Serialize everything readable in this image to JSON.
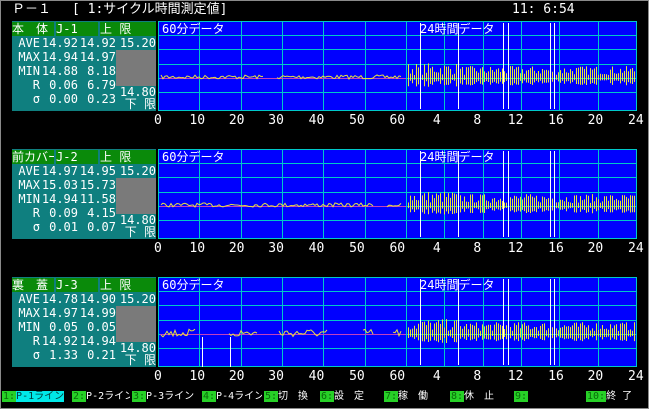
{
  "header": {
    "screen_id": "Ｐ－１",
    "title": "[ 1:サイクル時間測定値]",
    "clock": "11: 6:54"
  },
  "stat_labels": [
    "AVE",
    "MAX",
    "MIN",
    "R",
    "σ"
  ],
  "x_ticks": [
    "0",
    "10",
    "20",
    "30",
    "40",
    "50",
    "60",
    "4",
    "8",
    "12",
    "16",
    "20",
    "24"
  ],
  "panels": [
    {
      "name": "本　体",
      "code": "J-1",
      "upper_label": "上 限",
      "lower_label": "下 限",
      "upper_limit": "15.20",
      "lower_limit": "14.80",
      "stats": [
        [
          "14.92",
          "14.92"
        ],
        [
          "14.94",
          "14.97"
        ],
        [
          "14.88",
          "8.18"
        ],
        [
          "0.06",
          "6.79"
        ],
        [
          "0.00",
          "0.23"
        ]
      ],
      "chart_60min_title": "60分データ",
      "chart_24h_title": "24時間データ"
    },
    {
      "name": "前カバー",
      "code": "J-2",
      "upper_label": "上 限",
      "lower_label": "下 限",
      "upper_limit": "15.20",
      "lower_limit": "14.80",
      "stats": [
        [
          "14.97",
          "14.95"
        ],
        [
          "15.03",
          "15.73"
        ],
        [
          "14.94",
          "11.58"
        ],
        [
          "0.09",
          "4.15"
        ],
        [
          "0.01",
          "0.07"
        ]
      ],
      "chart_60min_title": "60分データ",
      "chart_24h_title": "24時間データ"
    },
    {
      "name": "裏　蓋",
      "code": "J-3",
      "upper_label": "上 限",
      "lower_label": "下 限",
      "upper_limit": "15.20",
      "lower_limit": "14.80",
      "stats": [
        [
          "14.78",
          "14.90"
        ],
        [
          "14.97",
          "14.99"
        ],
        [
          "0.05",
          "0.05"
        ],
        [
          "14.92",
          "14.94"
        ],
        [
          "1.33",
          "0.21"
        ]
      ],
      "chart_60min_title": "60分データ",
      "chart_24h_title": "24時間データ"
    }
  ],
  "function_keys": [
    {
      "num": "1:",
      "label": "P-1ライン"
    },
    {
      "num": "2:",
      "label": "P-2ライン"
    },
    {
      "num": "3:",
      "label": "P-3ライン"
    },
    {
      "num": "4:",
      "label": "P-4ライン"
    },
    {
      "num": "5:",
      "label": "切　換"
    },
    {
      "num": "6:",
      "label": "設　定"
    },
    {
      "num": "7:",
      "label": "稼　働"
    },
    {
      "num": "8:",
      "label": "休　止"
    },
    {
      "num": "9:",
      "label": ""
    },
    {
      "num": "10:",
      "label": "終 了"
    }
  ],
  "colors": {
    "plot_bg": "#0000ff",
    "grid": "#00c8c8",
    "trace": "#e8e040",
    "center_line": "#c040c0",
    "stats_bg": "#0f7f7f",
    "label_bg": "#0a8a0a",
    "fkey_num_bg": "#27d027",
    "fkey_sel_bg": "#00e8e8"
  }
}
